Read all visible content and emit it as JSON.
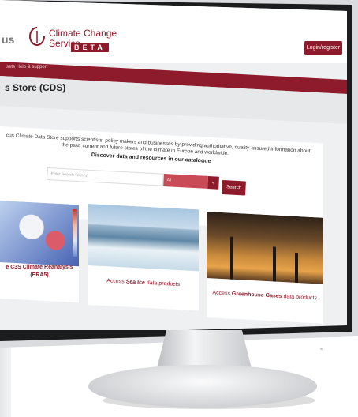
{
  "header": {
    "logo_text": "us",
    "brand_title_line1": "Climate Change",
    "brand_title_line2": "Service",
    "beta_badge": "BETA",
    "login_button": "Login/register",
    "nav_text": "sets   Help & support"
  },
  "page": {
    "title": "s Store (CDS)"
  },
  "intro": {
    "line1": "cus Climate Data Store supports scientists, policy makers and businesses by providing authoritative, quality-assured information about",
    "line2": "the past, current and future states of the climate in Europe and worldwide.",
    "discover_heading": "Discover data and resources in our catalogue"
  },
  "search": {
    "placeholder": "Enter Search Term(s)",
    "category_value": "All",
    "button_label": "Search"
  },
  "cards": [
    {
      "prefix": "",
      "highlight": "e C3S Climate Reanalysis (ERA5)",
      "suffix": ""
    },
    {
      "prefix": "Access ",
      "highlight": "Sea Ice",
      "suffix": " data products"
    },
    {
      "prefix": "Access ",
      "highlight": "Greenhouse Gases",
      "suffix": " data products"
    }
  ],
  "colors": {
    "brand": "#8e1b2b",
    "select_bg": "#c84b57"
  }
}
